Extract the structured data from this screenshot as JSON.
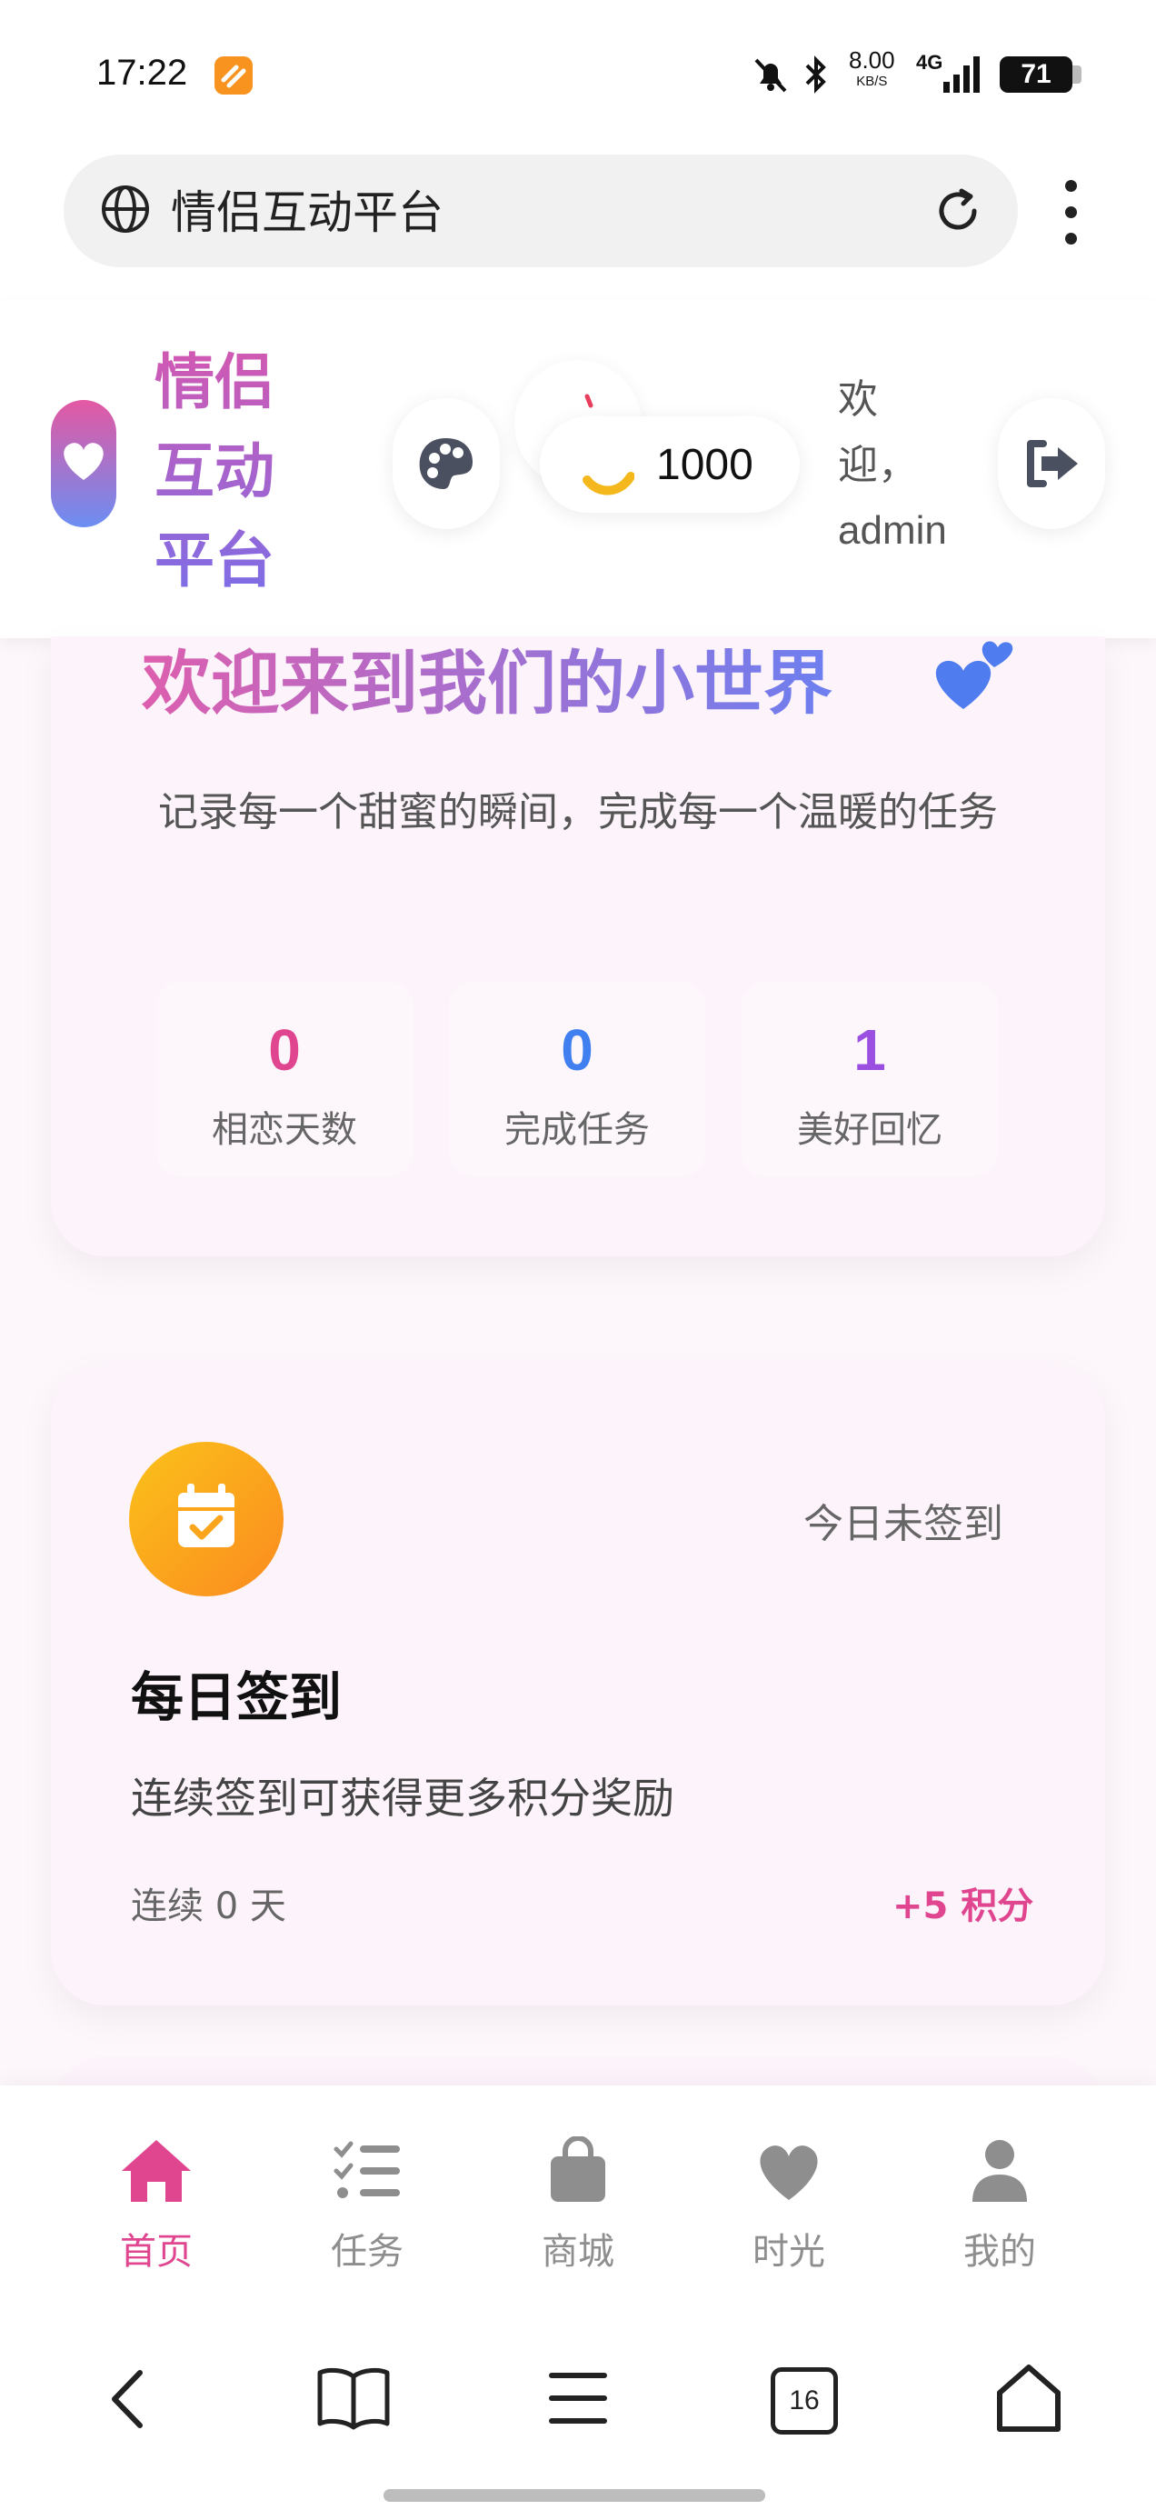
{
  "status_bar": {
    "time": "17:22",
    "net_speed": "8.00",
    "net_speed_unit": "KB/S",
    "network": "4G",
    "battery": "71"
  },
  "browser": {
    "url_title": "情侣互动平台",
    "tab_count": "16"
  },
  "header": {
    "brand_line1": "情侣",
    "brand_line2": "互动",
    "brand_line3": "平台",
    "points": "1000",
    "welcome_line1": "欢",
    "welcome_line2": "迎，",
    "welcome_line3": "admin"
  },
  "hero": {
    "title": "欢迎来到我们的小世界",
    "subtitle": "记录每一个甜蜜的瞬间，完成每一个温暖的任务",
    "stats": [
      {
        "value": "0",
        "label": "相恋天数",
        "color": "#e0468f"
      },
      {
        "value": "0",
        "label": "完成任务",
        "color": "#3f7ff0"
      },
      {
        "value": "1",
        "label": "美好回忆",
        "color": "#9a4fe0"
      }
    ]
  },
  "checkin": {
    "status": "今日未签到",
    "title": "每日签到",
    "description": "连续签到可获得更多积分奖励",
    "streak": "连续 0 天",
    "reward": "+5 积分"
  },
  "nav": {
    "items": [
      {
        "label": "首页",
        "icon": "home-icon",
        "active": true
      },
      {
        "label": "任务",
        "icon": "tasks-icon",
        "active": false
      },
      {
        "label": "商城",
        "icon": "shop-bag-icon",
        "active": false
      },
      {
        "label": "时光",
        "icon": "heart-icon",
        "active": false
      },
      {
        "label": "我的",
        "icon": "user-icon",
        "active": false
      }
    ]
  },
  "colors": {
    "accent_pink": "#e0468f",
    "accent_blue": "#3f7ff0",
    "accent_purple": "#9a4fe0",
    "checkin_orange": "#fbc21a"
  }
}
